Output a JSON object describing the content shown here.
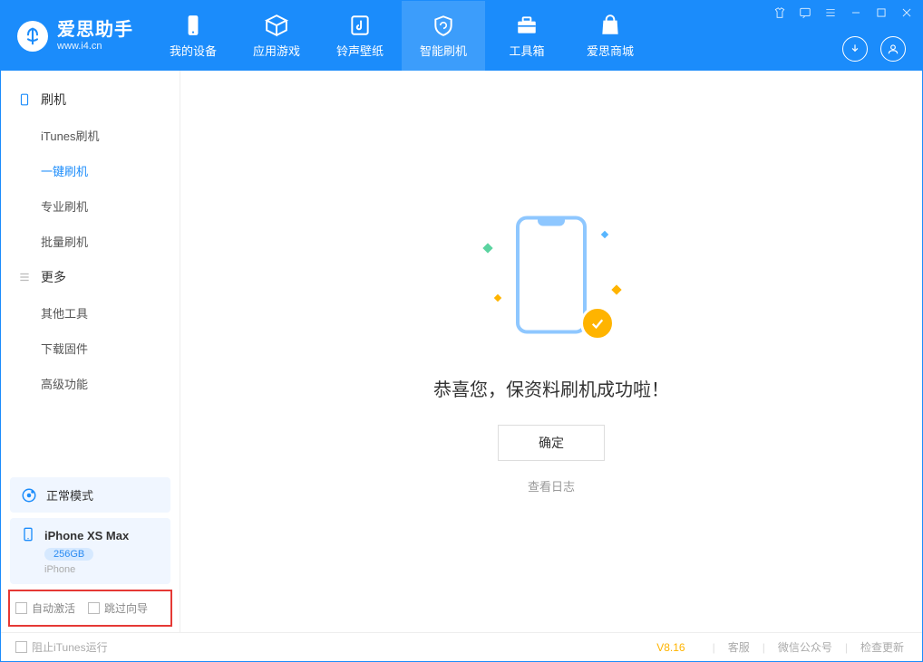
{
  "header": {
    "logo_main": "爱思助手",
    "logo_sub": "www.i4.cn",
    "navs": [
      {
        "label": "我的设备"
      },
      {
        "label": "应用游戏"
      },
      {
        "label": "铃声壁纸"
      },
      {
        "label": "智能刷机"
      },
      {
        "label": "工具箱"
      },
      {
        "label": "爱思商城"
      }
    ]
  },
  "sidebar": {
    "group1": {
      "title": "刷机",
      "items": [
        "iTunes刷机",
        "一键刷机",
        "专业刷机",
        "批量刷机"
      ]
    },
    "group2": {
      "title": "更多",
      "items": [
        "其他工具",
        "下载固件",
        "高级功能"
      ]
    },
    "mode": "正常模式",
    "device": {
      "name": "iPhone XS Max",
      "capacity": "256GB",
      "type": "iPhone"
    },
    "checks": {
      "auto_activate": "自动激活",
      "skip_guide": "跳过向导"
    }
  },
  "main": {
    "message": "恭喜您，保资料刷机成功啦！",
    "ok_button": "确定",
    "view_log": "查看日志"
  },
  "footer": {
    "block_itunes": "阻止iTunes运行",
    "version": "V8.16",
    "links": [
      "客服",
      "微信公众号",
      "检查更新"
    ]
  }
}
